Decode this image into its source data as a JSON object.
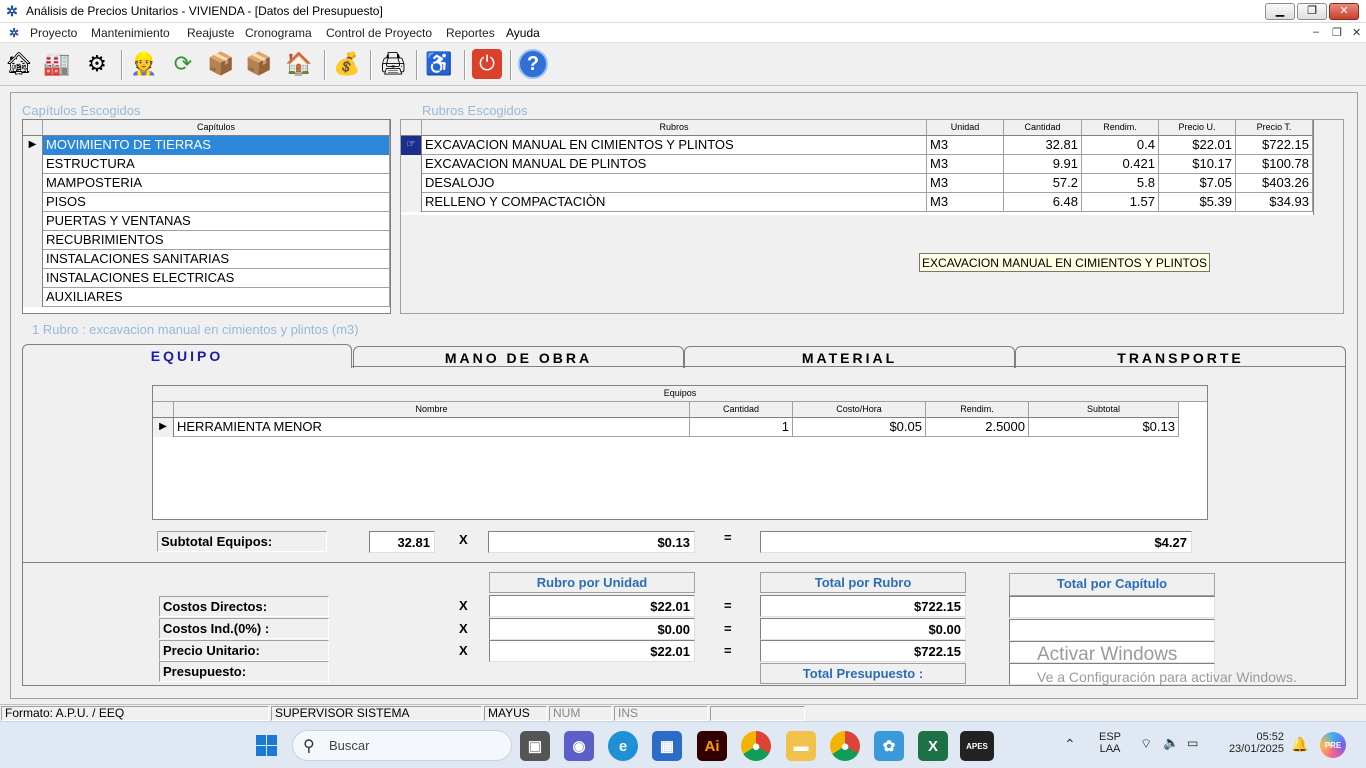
{
  "window": {
    "title": "Análisis de Precios Unitarios  -  VIVIENDA - [Datos del Presupuesto]",
    "min": "▁",
    "max": "❐",
    "close": "✕"
  },
  "menu": {
    "items": [
      "Proyecto",
      "Mantenimiento",
      "Reajuste",
      "Cronograma",
      "Control de Proyecto",
      "Reportes",
      "Ayuda"
    ],
    "mdi": [
      "–",
      "❐",
      "✕"
    ]
  },
  "toolbar": {
    "icons": [
      "open-project-icon",
      "warehouse-icon",
      "settings-icon",
      "workers-icon",
      "refresh-icon",
      "box-open-icon",
      "box-transfer-icon",
      "house-money-icon",
      "money-bag-icon",
      "printer-icon",
      "wheelchair-icon",
      "power-icon",
      "help-icon"
    ]
  },
  "capitulos": {
    "group_label": "Capítulos Escogidos",
    "header": "Capítulos",
    "items": [
      "MOVIMIENTO DE TIERRAS",
      "ESTRUCTURA",
      "MAMPOSTERIA",
      "PISOS",
      "PUERTAS Y VENTANAS",
      "RECUBRIMIENTOS",
      "INSTALACIONES SANITARIAS",
      "INSTALACIONES ELECTRICAS",
      "AUXILIARES"
    ]
  },
  "rubros": {
    "group_label": "Rubros Escogidos",
    "headers": [
      "Rubros",
      "Unidad",
      "Cantidad",
      "Rendim.",
      "Precio U.",
      "Precio T."
    ],
    "rows": [
      [
        "EXCAVACION MANUAL EN CIMIENTOS Y PLINTOS",
        "M3",
        "32.81",
        "0.4",
        "$22.01",
        "$722.15"
      ],
      [
        "EXCAVACION MANUAL DE PLINTOS",
        "M3",
        "9.91",
        "0.421",
        "$10.17",
        "$100.78"
      ],
      [
        "DESALOJO",
        "M3",
        "57.2",
        "5.8",
        "$7.05",
        "$403.26"
      ],
      [
        "RELLENO Y COMPACTACIÒN",
        "M3",
        "6.48",
        "1.57",
        "$5.39",
        "$34.93"
      ]
    ],
    "tooltip": "EXCAVACION MANUAL EN CIMIENTOS Y PLINTOS"
  },
  "rubro_caption": "1 Rubro : excavacion manual en cimientos y plintos (m3)",
  "tabs": [
    "EQUIPO",
    "MANO DE OBRA",
    "MATERIAL",
    "TRANSPORTE"
  ],
  "equipos": {
    "title": "Equipos",
    "headers": [
      "Nombre",
      "Cantidad",
      "Costo/Hora",
      "Rendim.",
      "Subtotal"
    ],
    "rows": [
      [
        "HERRAMIENTA MENOR",
        "1",
        "$0.05",
        "2.5000",
        "$0.13"
      ]
    ]
  },
  "subtotal": {
    "label": "Subtotal Equipos:",
    "cantidad": "32.81",
    "x": "X",
    "unit": "$0.13",
    "eq": "=",
    "total": "$4.27"
  },
  "summary": {
    "col_unidad": "Rubro por Unidad",
    "col_rubro": "Total por Rubro",
    "col_capitulo": "Total por Capítulo",
    "x": "X",
    "eq": "=",
    "rows": [
      {
        "label": "Costos Directos:",
        "unidad": "$22.01",
        "rubro": "$722.15"
      },
      {
        "label": "Costos Ind.(0%) :",
        "unidad": "$0.00",
        "rubro": "$0.00"
      },
      {
        "label": "Precio Unitario:",
        "unidad": "$22.01",
        "rubro": "$722.15"
      }
    ],
    "presupuesto_label": "Presupuesto:",
    "total_presupuesto": "Total Presupuesto :"
  },
  "watermark": {
    "line1": "Activar Windows",
    "line2": "Ve a Configuración para activar Windows."
  },
  "status": {
    "formato": "Formato: A.P.U. / EEQ",
    "user": "SUPERVISOR SISTEMA",
    "mayus": "MAYUS",
    "num": "NUM",
    "ins": "INS"
  },
  "taskbar": {
    "search": "Buscar",
    "lang": "ESP",
    "layout": "LAA",
    "time": "05:52",
    "date": "23/01/2025"
  },
  "colors": {
    "selection": "#2c87d9",
    "accent_header": "#2a6ebb",
    "tab_active": "#1b1ba8",
    "group_label": "#98b8d8"
  }
}
